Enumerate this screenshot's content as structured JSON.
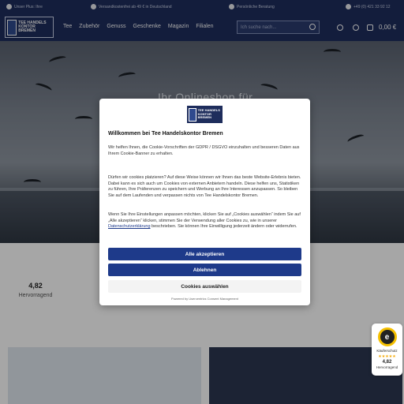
{
  "topbar": {
    "items": [
      "Unser Plus: Ihre",
      "Versandkostenfrei ab 49 € in Deutschland",
      "Persönliche Beratung",
      "+49 (0) 421 33 92 12"
    ]
  },
  "header": {
    "logo_text": "TEE HANDELS KONTOR BREMEN",
    "nav": [
      "Tee",
      "Zubehör",
      "Genuss",
      "Geschenke",
      "Magazin",
      "Filialen"
    ],
    "search_placeholder": "Ich suche nach...",
    "cart_total": "0,00 €"
  },
  "hero": {
    "title": "Ihr Onlineshop für"
  },
  "rating": {
    "score": "4,82",
    "label": "Hervorragend"
  },
  "cookie": {
    "logo_text": "TEE HANDELS KONTOR BREMEN",
    "title": "Willkommen bei Tee Handelskontor Bremen",
    "p1": "Wir helfen Ihnen, die Cookie-Vorschriften der GDPR / DSGVO einzuhalten und besseren Daten aus Ihrem Cookie-Banner zu erhalten.",
    "p2": "Dürfen wir cookies platzieren? Auf diese Weise können wir Ihnen das beste Website-Erlebnis bieten. Dabei kann es sich auch um Cookies von externen Anbietern handeln. Diese helfen uns, Statistiken zu führen, Ihre Präferenzen zu speichern und Werbung an Ihre Interessen anzupassen. So bleiben Sie auf dem Laufenden und verpassen nichts von Tee Handelskontor Bremen.",
    "p3_before": "Wenn Sie Ihre Einstellungen anpassen möchten, klicken Sie auf „Cookies auswählen“ indem Sie auf „Alle akzeptieren“ klicken, stimmen Sie der Verwendung aller Cookies zu, wie in unserer ",
    "p3_link": "Datenschutzerklärung",
    "p3_after": " beschrieben. Sie können Ihre Einwilligung jederzeit ändern oder widerrufen.",
    "btn_accept": "Alle akzeptieren",
    "btn_decline": "Ablehnen",
    "btn_select": "Cookies auswählen",
    "footer": "Powered by Usercentrics Consent Management"
  },
  "badge": {
    "seal": "e",
    "title": "Käuferschutz",
    "stars": "★★★★★",
    "score": "4,82",
    "label": "Hervorragend"
  }
}
